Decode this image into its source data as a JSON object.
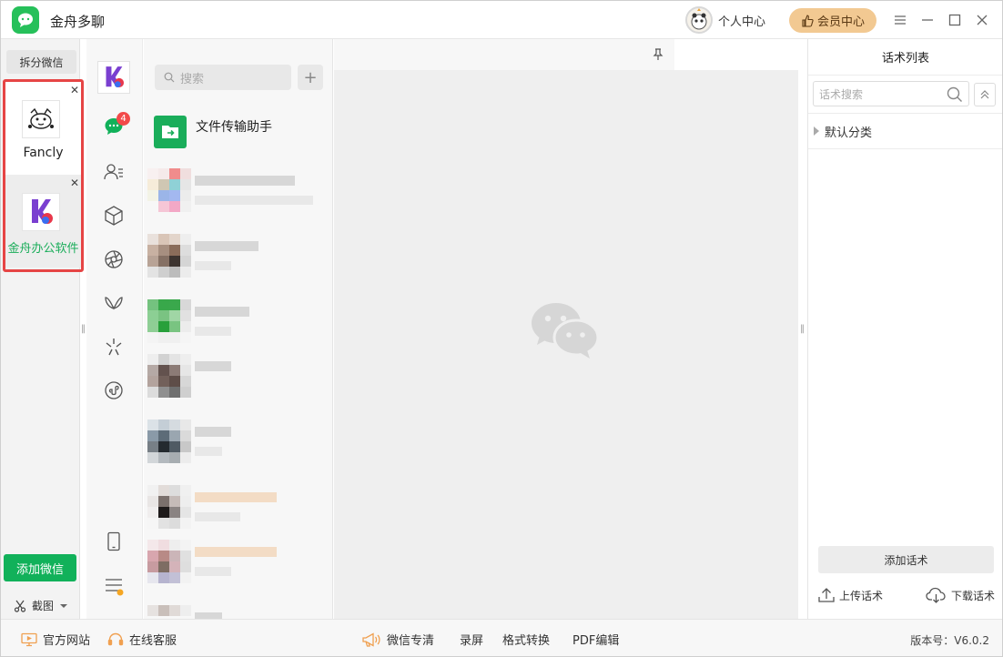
{
  "app": {
    "title": "金舟多聊"
  },
  "header": {
    "profile_label": "个人中心",
    "vip_label": "会员中心"
  },
  "left": {
    "split_label": "拆分微信",
    "accounts": [
      {
        "name": "Fancly"
      },
      {
        "name": "金舟办公软件"
      }
    ],
    "add_label": "添加微信",
    "screenshot_label": "截图"
  },
  "nav": {
    "unread_badge": "4"
  },
  "chats": {
    "search_placeholder": "搜索",
    "file_helper": "文件传输助手"
  },
  "right": {
    "title": "话术列表",
    "search_placeholder": "话术搜索",
    "category": "默认分类",
    "add_label": "添加话术",
    "upload_label": "上传话术",
    "download_label": "下载话术"
  },
  "status": {
    "website": "官方网站",
    "service": "在线客服",
    "clean": "微信专清",
    "record": "录屏",
    "convert": "格式转换",
    "pdf": "PDF编辑",
    "version": "版本号：V6.0.2"
  },
  "colors": {
    "green": "#11b15a",
    "highlight": "#e64545",
    "vip": "#f2c992"
  }
}
